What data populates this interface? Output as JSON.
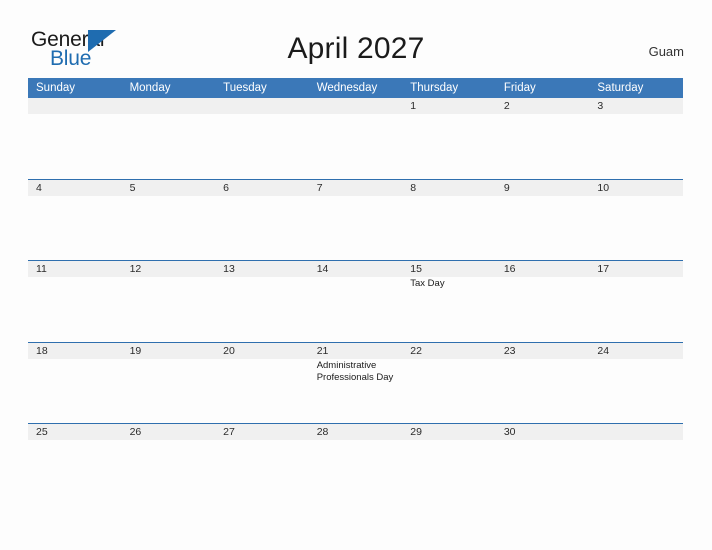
{
  "logo": {
    "word_top": "General",
    "word_bottom": "Blue",
    "triangle_color": "#1f6cb0",
    "icon": "triangle-icon"
  },
  "header": {
    "title": "April 2027",
    "region": "Guam"
  },
  "colors": {
    "header_blue": "#3b78b8",
    "row_line_blue": "#2f6fae",
    "date_band_gray": "#f0f0f0",
    "page_background": "#fdfdfd",
    "logo_blue": "#1f6cb0"
  },
  "calendar": {
    "month": "April",
    "year": "2027",
    "weekdays": [
      "Sunday",
      "Monday",
      "Tuesday",
      "Wednesday",
      "Thursday",
      "Friday",
      "Saturday"
    ],
    "weeks": [
      [
        {
          "date": "",
          "event": ""
        },
        {
          "date": "",
          "event": ""
        },
        {
          "date": "",
          "event": ""
        },
        {
          "date": "",
          "event": ""
        },
        {
          "date": "1",
          "event": ""
        },
        {
          "date": "2",
          "event": ""
        },
        {
          "date": "3",
          "event": ""
        }
      ],
      [
        {
          "date": "4",
          "event": ""
        },
        {
          "date": "5",
          "event": ""
        },
        {
          "date": "6",
          "event": ""
        },
        {
          "date": "7",
          "event": ""
        },
        {
          "date": "8",
          "event": ""
        },
        {
          "date": "9",
          "event": ""
        },
        {
          "date": "10",
          "event": ""
        }
      ],
      [
        {
          "date": "11",
          "event": ""
        },
        {
          "date": "12",
          "event": ""
        },
        {
          "date": "13",
          "event": ""
        },
        {
          "date": "14",
          "event": ""
        },
        {
          "date": "15",
          "event": "Tax Day"
        },
        {
          "date": "16",
          "event": ""
        },
        {
          "date": "17",
          "event": ""
        }
      ],
      [
        {
          "date": "18",
          "event": ""
        },
        {
          "date": "19",
          "event": ""
        },
        {
          "date": "20",
          "event": ""
        },
        {
          "date": "21",
          "event": "Administrative Professionals Day"
        },
        {
          "date": "22",
          "event": ""
        },
        {
          "date": "23",
          "event": ""
        },
        {
          "date": "24",
          "event": ""
        }
      ],
      [
        {
          "date": "25",
          "event": ""
        },
        {
          "date": "26",
          "event": ""
        },
        {
          "date": "27",
          "event": ""
        },
        {
          "date": "28",
          "event": ""
        },
        {
          "date": "29",
          "event": ""
        },
        {
          "date": "30",
          "event": ""
        },
        {
          "date": "",
          "event": ""
        }
      ]
    ]
  }
}
